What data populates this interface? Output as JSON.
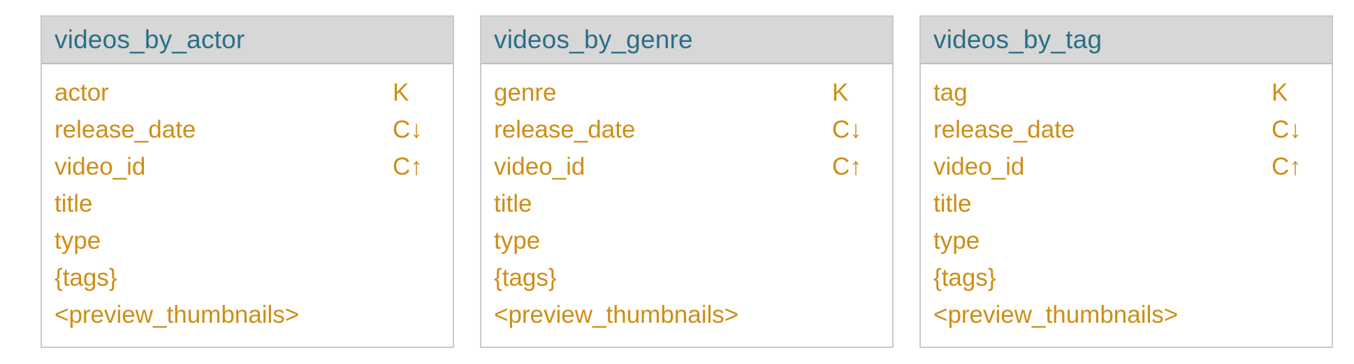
{
  "tables": [
    {
      "title": "videos_by_actor",
      "columns": [
        {
          "name": "actor",
          "key": "K"
        },
        {
          "name": "release_date",
          "key": "C↓"
        },
        {
          "name": "video_id",
          "key": "C↑"
        },
        {
          "name": "title",
          "key": ""
        },
        {
          "name": "type",
          "key": ""
        },
        {
          "name": "{tags}",
          "key": ""
        },
        {
          "name": "<preview_thumbnails>",
          "key": ""
        }
      ]
    },
    {
      "title": "videos_by_genre",
      "columns": [
        {
          "name": "genre",
          "key": "K"
        },
        {
          "name": "release_date",
          "key": "C↓"
        },
        {
          "name": "video_id",
          "key": "C↑"
        },
        {
          "name": "title",
          "key": ""
        },
        {
          "name": "type",
          "key": ""
        },
        {
          "name": "{tags}",
          "key": ""
        },
        {
          "name": "<preview_thumbnails>",
          "key": ""
        }
      ]
    },
    {
      "title": "videos_by_tag",
      "columns": [
        {
          "name": "tag",
          "key": "K"
        },
        {
          "name": "release_date",
          "key": "C↓"
        },
        {
          "name": "video_id",
          "key": "C↑"
        },
        {
          "name": "title",
          "key": ""
        },
        {
          "name": "type",
          "key": ""
        },
        {
          "name": "{tags}",
          "key": ""
        },
        {
          "name": "<preview_thumbnails>",
          "key": ""
        }
      ]
    }
  ]
}
